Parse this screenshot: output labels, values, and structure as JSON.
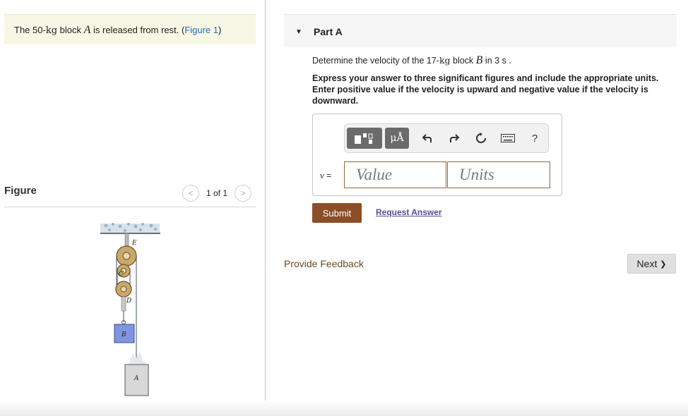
{
  "problem": {
    "text_prefix": "The 50-",
    "mass_unit": "kg",
    "text_mid": " block ",
    "block_var": "A",
    "text_suffix": " is released from rest. (",
    "figure_link": "Figure 1",
    "text_close": ")"
  },
  "figure": {
    "title": "Figure",
    "pager_text": "1 of 1",
    "labels": {
      "E": "E",
      "C": "C",
      "D": "D",
      "B": "B",
      "A": "A"
    }
  },
  "part": {
    "title": "Part A"
  },
  "question": {
    "prefix": "Determine the velocity of the 17-",
    "mass_unit": "kg",
    "mid": " block ",
    "block_var": "B",
    "suffix": " in 3 ",
    "time_unit": "s",
    "end": " ."
  },
  "instructions": "Express your answer to three significant figures and include the appropriate units. Enter positive value if the velocity is upward and negative value if the velocity is downward.",
  "toolbar": {
    "units_label": "μÅ",
    "help_label": "?",
    "icons": [
      "template-icon",
      "units-icon",
      "undo-icon",
      "redo-icon",
      "reset-icon",
      "keyboard-icon",
      "help-icon"
    ]
  },
  "answer": {
    "variable": "v",
    "equals": " =",
    "value_placeholder": "Value",
    "units_placeholder": "Units"
  },
  "actions": {
    "submit": "Submit",
    "request_answer": "Request Answer",
    "provide_feedback": "Provide Feedback",
    "next": "Next",
    "next_arrow": "❯"
  },
  "colors": {
    "submit_bg": "#8b4e26",
    "link": "#1f6fbf",
    "request_link": "#5b4b99",
    "problem_bg": "#f7f7e5",
    "block_b": "#7f95e0",
    "block_a": "#d8d8d8"
  }
}
